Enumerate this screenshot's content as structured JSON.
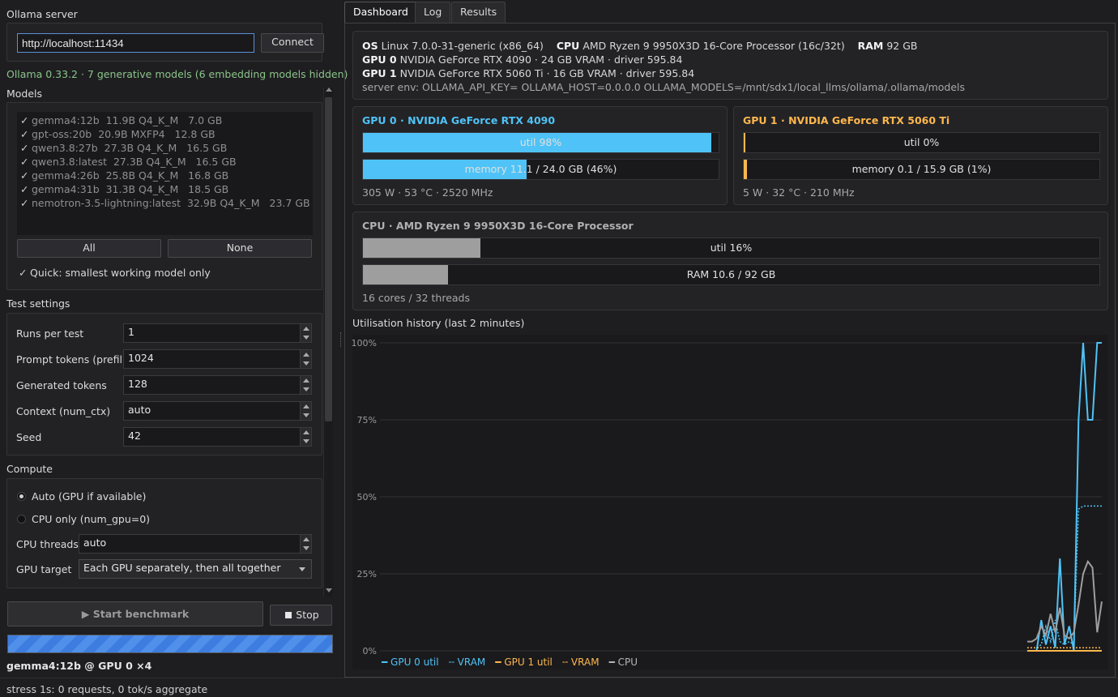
{
  "server": {
    "title": "Ollama server",
    "url": "http://localhost:11434",
    "connect_label": "Connect",
    "status": "Ollama 0.33.2 · 7 generative models (6 embedding models hidden)"
  },
  "models": {
    "title": "Models",
    "items": [
      {
        "name": "gemma4:12b",
        "info": "11.9B Q4_K_M   7.0 GB"
      },
      {
        "name": "gpt-oss:20b",
        "info": "20.9B MXFP4   12.8 GB"
      },
      {
        "name": "qwen3.8:27b",
        "info": "27.3B Q4_K_M   16.5 GB"
      },
      {
        "name": "qwen3.8:latest",
        "info": "27.3B Q4_K_M   16.5 GB"
      },
      {
        "name": "gemma4:26b",
        "info": "25.8B Q4_K_M   16.8 GB"
      },
      {
        "name": "gemma4:31b",
        "info": "31.3B Q4_K_M   18.5 GB"
      },
      {
        "name": "nemotron-3.5-lightning:latest",
        "info": "32.9B Q4_K_M   23.7 GB"
      }
    ],
    "all_label": "All",
    "none_label": "None",
    "quick_label": "Quick: smallest working model only"
  },
  "test_settings": {
    "title": "Test settings",
    "runs_label": "Runs per test",
    "runs_value": "1",
    "prompt_label": "Prompt tokens (prefill)",
    "prompt_value": "1024",
    "gen_label": "Generated tokens",
    "gen_value": "128",
    "ctx_label": "Context (num_ctx)",
    "ctx_value": "auto",
    "seed_label": "Seed",
    "seed_value": "42"
  },
  "compute": {
    "title": "Compute",
    "auto_label": "Auto (GPU if available)",
    "cpu_label": "CPU only (num_gpu=0)",
    "threads_label": "CPU threads",
    "threads_value": "auto",
    "gpu_target_label": "GPU target",
    "gpu_target_value": "Each GPU separately, then all together"
  },
  "actions": {
    "start_label": "Start benchmark",
    "stop_label": "Stop",
    "progress": 1.0,
    "current_job": "gemma4:12b @ GPU 0 ×4"
  },
  "status_bar": "stress 1s: 0 requests, 0 tok/s aggregate",
  "tabs": [
    "Dashboard",
    "Log",
    "Results"
  ],
  "sysinfo": {
    "os_key": "OS",
    "os_val": "Linux 7.0.0-31-generic (x86_64)",
    "cpu_key": "CPU",
    "cpu_val": "AMD Ryzen 9 9950X3D 16-Core Processor (16c/32t)",
    "ram_key": "RAM",
    "ram_val": "92 GB",
    "gpu0_key": "GPU 0",
    "gpu0_val": "NVIDIA GeForce RTX 4090 · 24 GB VRAM · driver 595.84",
    "gpu1_key": "GPU 1",
    "gpu1_val": "NVIDIA GeForce RTX 5060 Ti · 16 GB VRAM · driver 595.84",
    "env": "server env: OLLAMA_API_KEY= OLLAMA_HOST=0.0.0.0 OLLAMA_MODELS=/mnt/sdx1/local_llms/ollama/.ollama/models"
  },
  "gpu0": {
    "title": "GPU 0 · NVIDIA GeForce RTX 4090",
    "util_text": "util 98%",
    "util": 0.98,
    "mem_text": "memory 11.1 / 24.0 GB (46%)",
    "mem": 0.46,
    "stats": "305 W · 53 °C · 2520 MHz",
    "color": "#4fc3f7"
  },
  "gpu1": {
    "title": "GPU 1 · NVIDIA GeForce RTX 5060 Ti",
    "util_text": "util 0%",
    "util": 0.0,
    "mem_text": "memory 0.1 / 15.9 GB (1%)",
    "mem": 0.01,
    "stats": "5 W · 32 °C · 210 MHz",
    "color": "#ffb74d"
  },
  "cpu": {
    "title": "CPU · AMD Ryzen 9 9950X3D 16-Core Processor",
    "util_text": "util 16%",
    "util": 0.16,
    "ram_text": "RAM 10.6 / 92 GB",
    "ram": 0.115,
    "stats": "16 cores / 32 threads",
    "color": "#9e9e9e"
  },
  "chart_data": {
    "type": "line",
    "title": "Utilisation history (last 2 minutes)",
    "ylim": [
      0,
      100
    ],
    "yticks": [
      "0%",
      "25%",
      "50%",
      "75%",
      "100%"
    ],
    "yvalues": [
      0,
      25,
      50,
      75,
      100
    ],
    "x": [
      0,
      1,
      2,
      3,
      4,
      5,
      6,
      7,
      8,
      9,
      10,
      11,
      12,
      13,
      14,
      15,
      16,
      17,
      18,
      19,
      20,
      21,
      22,
      23,
      24,
      25,
      26,
      27,
      28,
      29,
      30,
      31,
      32,
      33,
      34,
      35,
      36,
      37,
      38,
      39,
      40,
      41,
      42,
      43,
      44,
      45,
      46,
      47,
      48,
      49,
      50,
      51,
      52,
      53,
      54,
      55,
      56,
      57,
      58,
      59,
      60
    ],
    "series": [
      {
        "name": "GPU 0 util",
        "color": "#4fc3f7",
        "dashed": false,
        "values": [
          null,
          null,
          null,
          null,
          null,
          null,
          null,
          null,
          null,
          null,
          null,
          null,
          null,
          null,
          null,
          null,
          null,
          null,
          null,
          null,
          null,
          null,
          null,
          null,
          null,
          null,
          null,
          null,
          null,
          null,
          null,
          null,
          null,
          null,
          null,
          null,
          null,
          null,
          null,
          null,
          null,
          null,
          null,
          null,
          null,
          null,
          null,
          null,
          null,
          0,
          0,
          0,
          10,
          2,
          8,
          1,
          30,
          2,
          8,
          0,
          75,
          100,
          75,
          75,
          100,
          100
        ]
      },
      {
        "name": "VRAM",
        "color": "#4fc3f7",
        "dashed": true,
        "values": [
          null,
          null,
          null,
          null,
          null,
          null,
          null,
          null,
          null,
          null,
          null,
          null,
          null,
          null,
          null,
          null,
          null,
          null,
          null,
          null,
          null,
          null,
          null,
          null,
          null,
          null,
          null,
          null,
          null,
          null,
          null,
          null,
          null,
          null,
          null,
          null,
          null,
          null,
          null,
          null,
          null,
          null,
          null,
          null,
          null,
          null,
          null,
          null,
          null,
          1,
          1,
          1,
          2,
          8,
          3,
          10,
          3,
          2,
          3,
          2,
          46,
          47,
          47,
          47,
          47,
          47
        ]
      },
      {
        "name": "GPU 1 util",
        "color": "#ffb74d",
        "dashed": false,
        "values": [
          null,
          null,
          null,
          null,
          null,
          null,
          null,
          null,
          null,
          null,
          null,
          null,
          null,
          null,
          null,
          null,
          null,
          null,
          null,
          null,
          null,
          null,
          null,
          null,
          null,
          null,
          null,
          null,
          null,
          null,
          null,
          null,
          null,
          null,
          null,
          null,
          null,
          null,
          null,
          null,
          null,
          null,
          null,
          null,
          null,
          null,
          null,
          null,
          null,
          0,
          0,
          0,
          0,
          0,
          0,
          0,
          0,
          0,
          0,
          0,
          0,
          0,
          0,
          0,
          0,
          0
        ]
      },
      {
        "name": "VRAM",
        "color": "#ffb74d",
        "dashed": true,
        "values": [
          null,
          null,
          null,
          null,
          null,
          null,
          null,
          null,
          null,
          null,
          null,
          null,
          null,
          null,
          null,
          null,
          null,
          null,
          null,
          null,
          null,
          null,
          null,
          null,
          null,
          null,
          null,
          null,
          null,
          null,
          null,
          null,
          null,
          null,
          null,
          null,
          null,
          null,
          null,
          null,
          null,
          null,
          null,
          null,
          null,
          null,
          null,
          null,
          null,
          1,
          1,
          1,
          1,
          1,
          1,
          1,
          1,
          1,
          1,
          1,
          1,
          1,
          1,
          1,
          1,
          1
        ]
      },
      {
        "name": "CPU",
        "color": "#9e9e9e",
        "dashed": false,
        "values": [
          null,
          null,
          null,
          null,
          null,
          null,
          null,
          null,
          null,
          null,
          null,
          null,
          null,
          null,
          null,
          null,
          null,
          null,
          null,
          null,
          null,
          null,
          null,
          null,
          null,
          null,
          null,
          null,
          null,
          null,
          null,
          null,
          null,
          null,
          null,
          null,
          null,
          null,
          null,
          null,
          null,
          null,
          null,
          null,
          null,
          null,
          null,
          null,
          null,
          3,
          3,
          4,
          8,
          5,
          12,
          6,
          14,
          5,
          4,
          6,
          15,
          25,
          29,
          27,
          6,
          16
        ]
      }
    ]
  }
}
